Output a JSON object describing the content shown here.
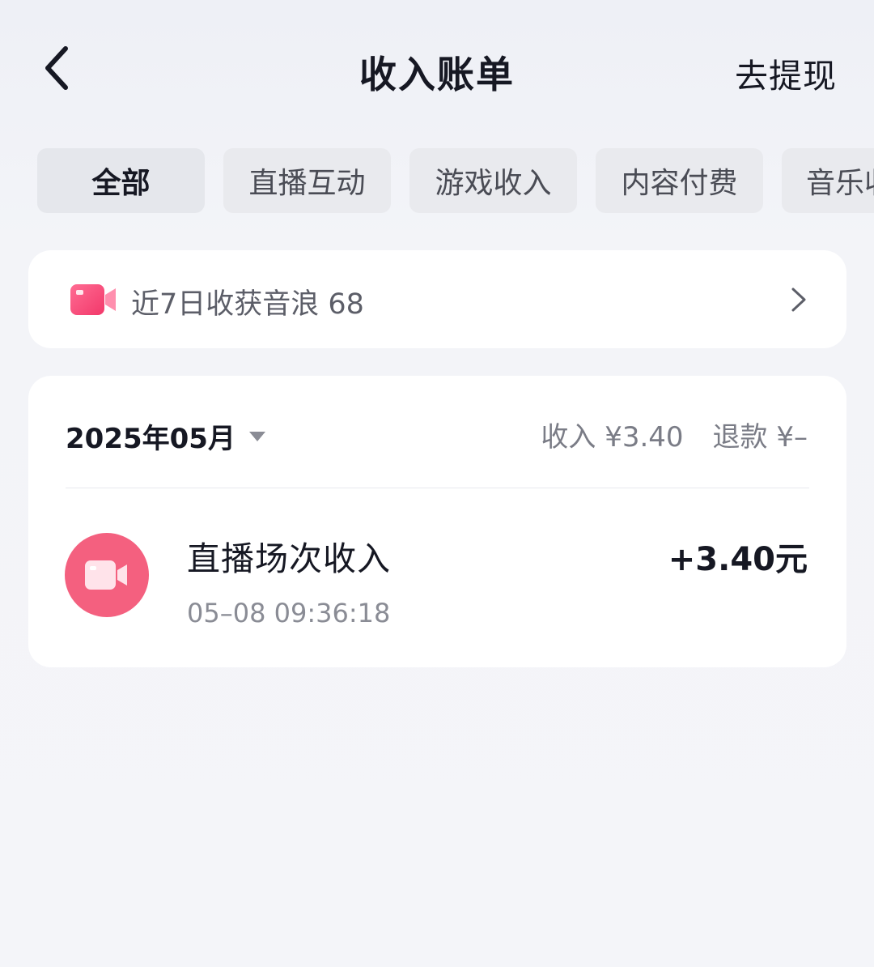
{
  "header": {
    "title": "收入账单",
    "withdraw_label": "去提现",
    "back_icon": "chevron-left-icon"
  },
  "tabs": [
    {
      "label": "全部",
      "active": true
    },
    {
      "label": "直播互动",
      "active": false
    },
    {
      "label": "游戏收入",
      "active": false
    },
    {
      "label": "内容付费",
      "active": false
    },
    {
      "label": "音乐收",
      "active": false
    }
  ],
  "summary": {
    "text": "近7日收获音浪 68",
    "icon": "video-camera-icon",
    "icon_color": "#f94f78"
  },
  "bill": {
    "month": "2025年05月",
    "income_total": "收入 ¥3.40",
    "refund_total": "退款 ¥–",
    "records": [
      {
        "title": "直播场次收入",
        "time": "05–08 09:36:18",
        "amount": "+3.40元",
        "icon": "video-camera-icon",
        "icon_bg": "#f4607f"
      }
    ]
  }
}
